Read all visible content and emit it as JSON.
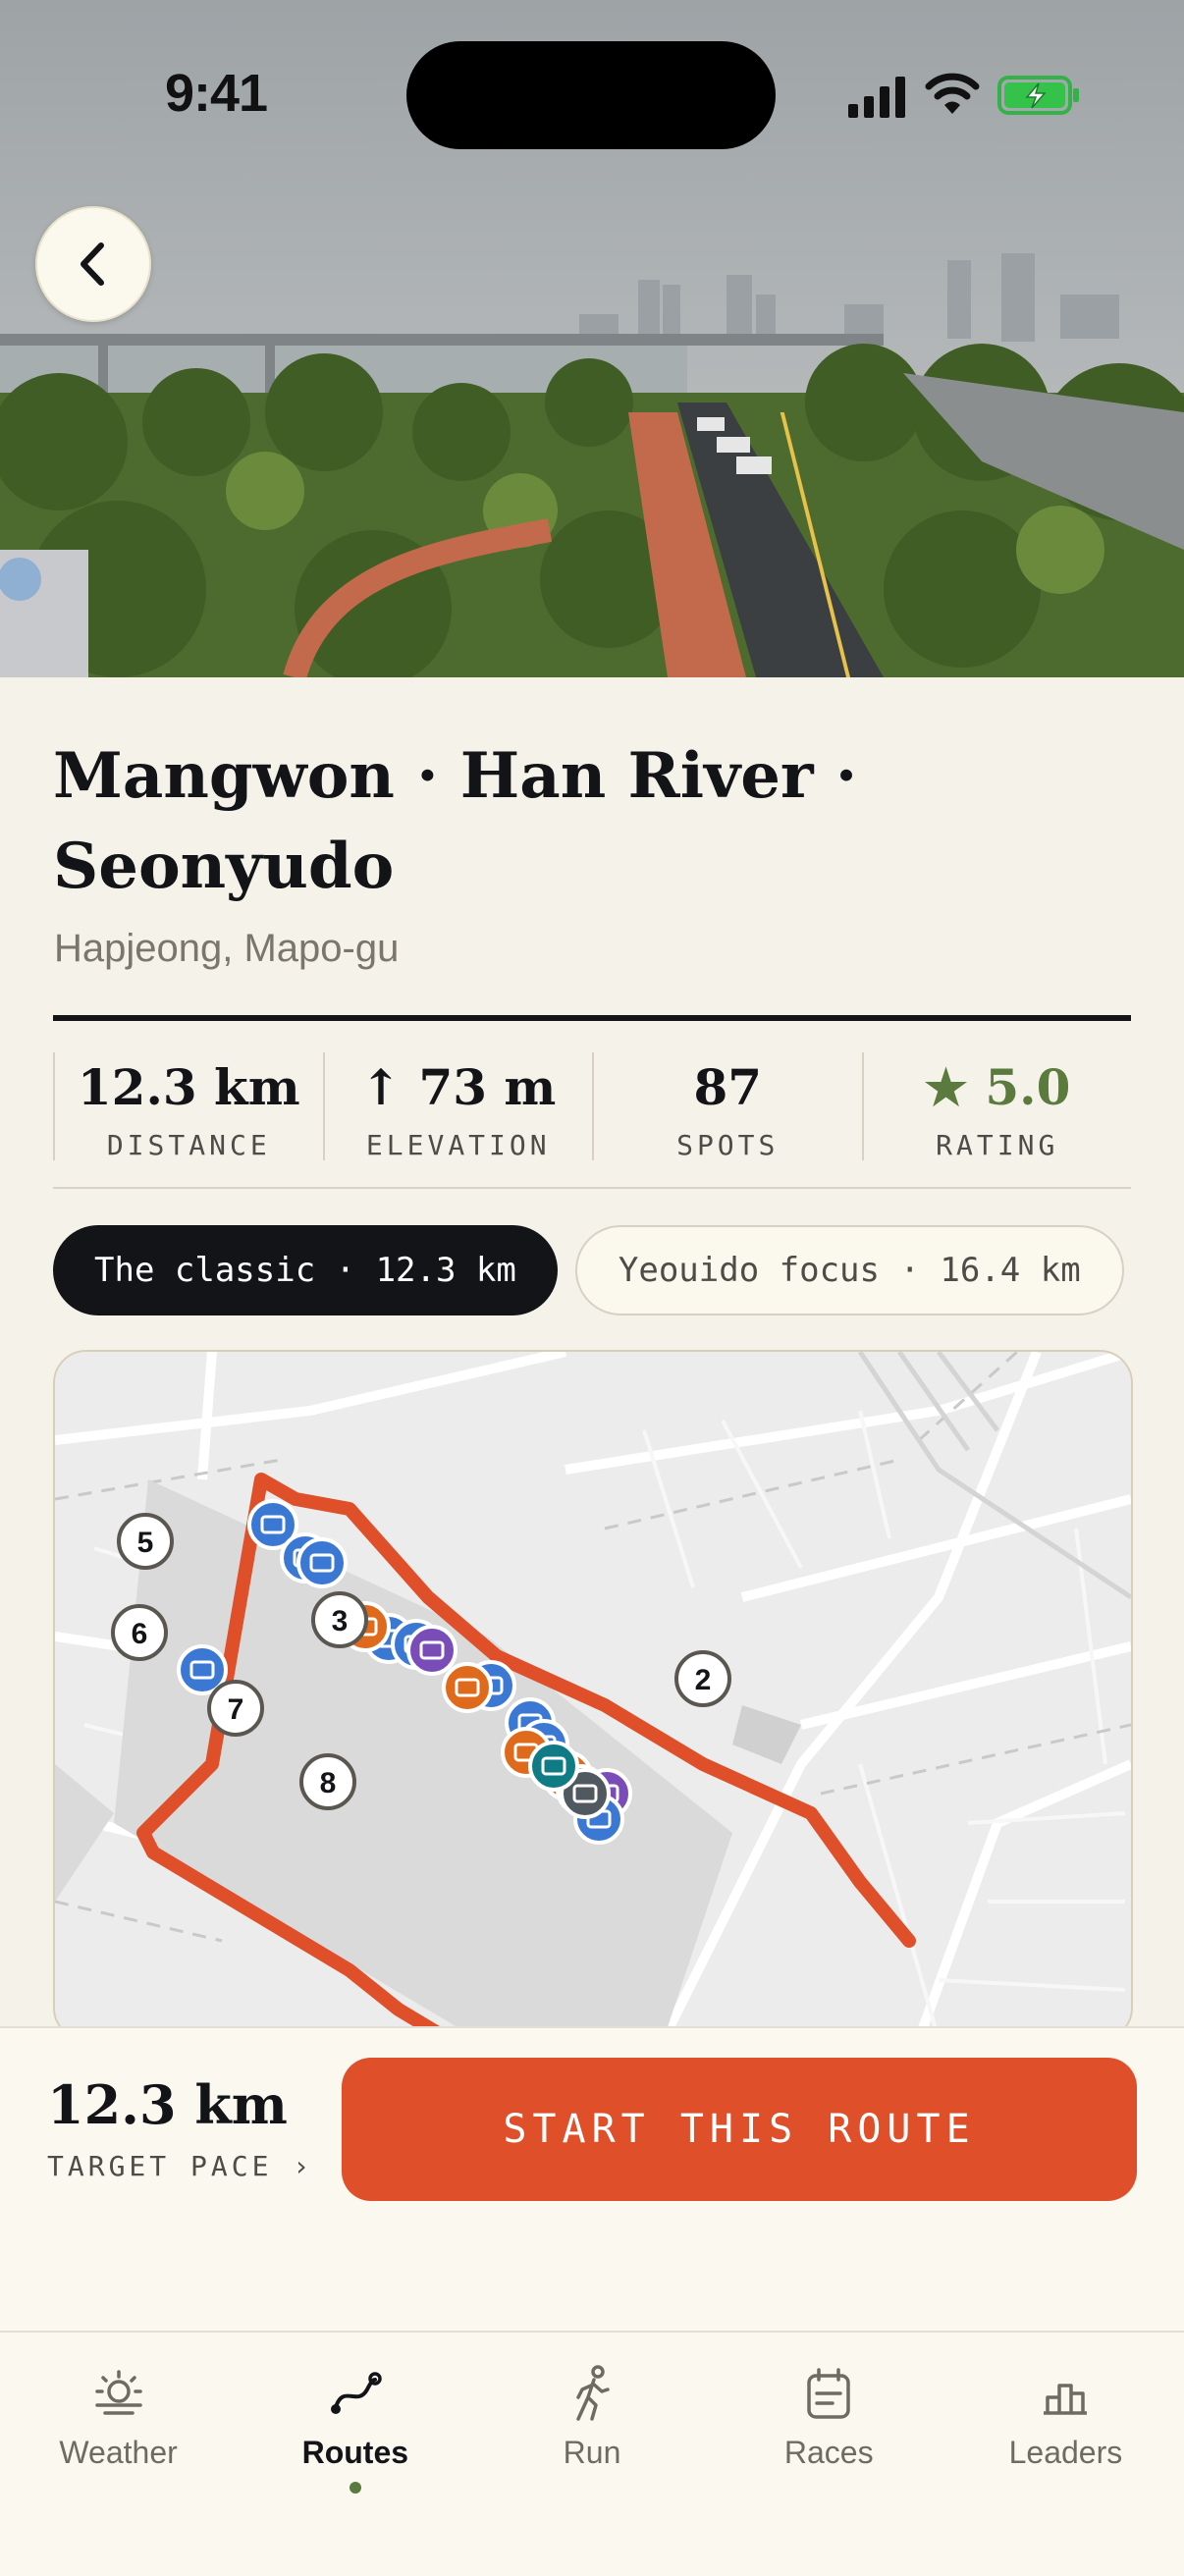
{
  "status_bar": {
    "time": "9:41"
  },
  "route": {
    "title": "Mangwon · Han River · Seonyudo",
    "location": "Hapjeong, Mapo-gu"
  },
  "stats": [
    {
      "value": "12.3 km",
      "label": "DISTANCE"
    },
    {
      "value": "↑ 73 m",
      "label": "ELEVATION"
    },
    {
      "value": "87",
      "label": "SPOTS"
    },
    {
      "value": "★ 5.0",
      "label": "RATING"
    }
  ],
  "variants": [
    {
      "label": "The classic · 12.3 km",
      "selected": true
    },
    {
      "label": "Yeouido focus · 16.4 km",
      "selected": false
    }
  ],
  "map": {
    "markers": [
      "2",
      "3",
      "5",
      "6",
      "7",
      "8"
    ]
  },
  "cta": {
    "distance": "12.3 km",
    "pace_label": "TARGET PACE ›",
    "button_label": "START THIS ROUTE"
  },
  "tabs": [
    {
      "label": "Weather",
      "icon": "sun-horizon-icon",
      "active": false
    },
    {
      "label": "Routes",
      "icon": "route-icon",
      "active": true
    },
    {
      "label": "Run",
      "icon": "runner-icon",
      "active": false
    },
    {
      "label": "Races",
      "icon": "calendar-icon",
      "active": false
    },
    {
      "label": "Leaders",
      "icon": "bar-chart-icon",
      "active": false
    }
  ],
  "colors": {
    "accent": "#df4f2a",
    "ink": "#121417",
    "rating_green": "#5b7a3e",
    "background": "#f5f2ea",
    "marker_blue": "#3a78d4",
    "marker_orange": "#df6a1c",
    "marker_purple": "#7a4cb8"
  }
}
